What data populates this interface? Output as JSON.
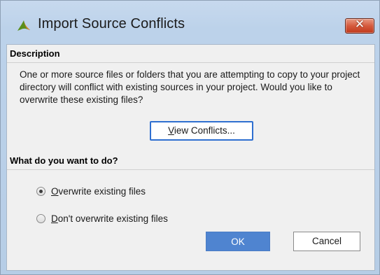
{
  "window": {
    "title": "Import Source Conflicts",
    "close_label": "✕",
    "app_icon": "vivado-leaf-icon"
  },
  "description": {
    "header": "Description",
    "text": "One or more source files or folders that you are attempting to copy to your project directory will conflict with existing sources in your project. Would you like to overwrite these existing files?",
    "view_button": {
      "mnemonic": "V",
      "rest": "iew Conflicts..."
    }
  },
  "question": {
    "header": "What do you want to do?",
    "options": [
      {
        "mnemonic": "O",
        "rest": "verwrite existing files",
        "selected": true
      },
      {
        "mnemonic": "D",
        "rest": "on't overwrite existing files",
        "selected": false
      }
    ]
  },
  "buttons": {
    "ok": "OK",
    "cancel": "Cancel"
  },
  "colors": {
    "accent": "#4f84d0",
    "close": "#d55a3d",
    "title_bg": "#bcd2ea"
  }
}
